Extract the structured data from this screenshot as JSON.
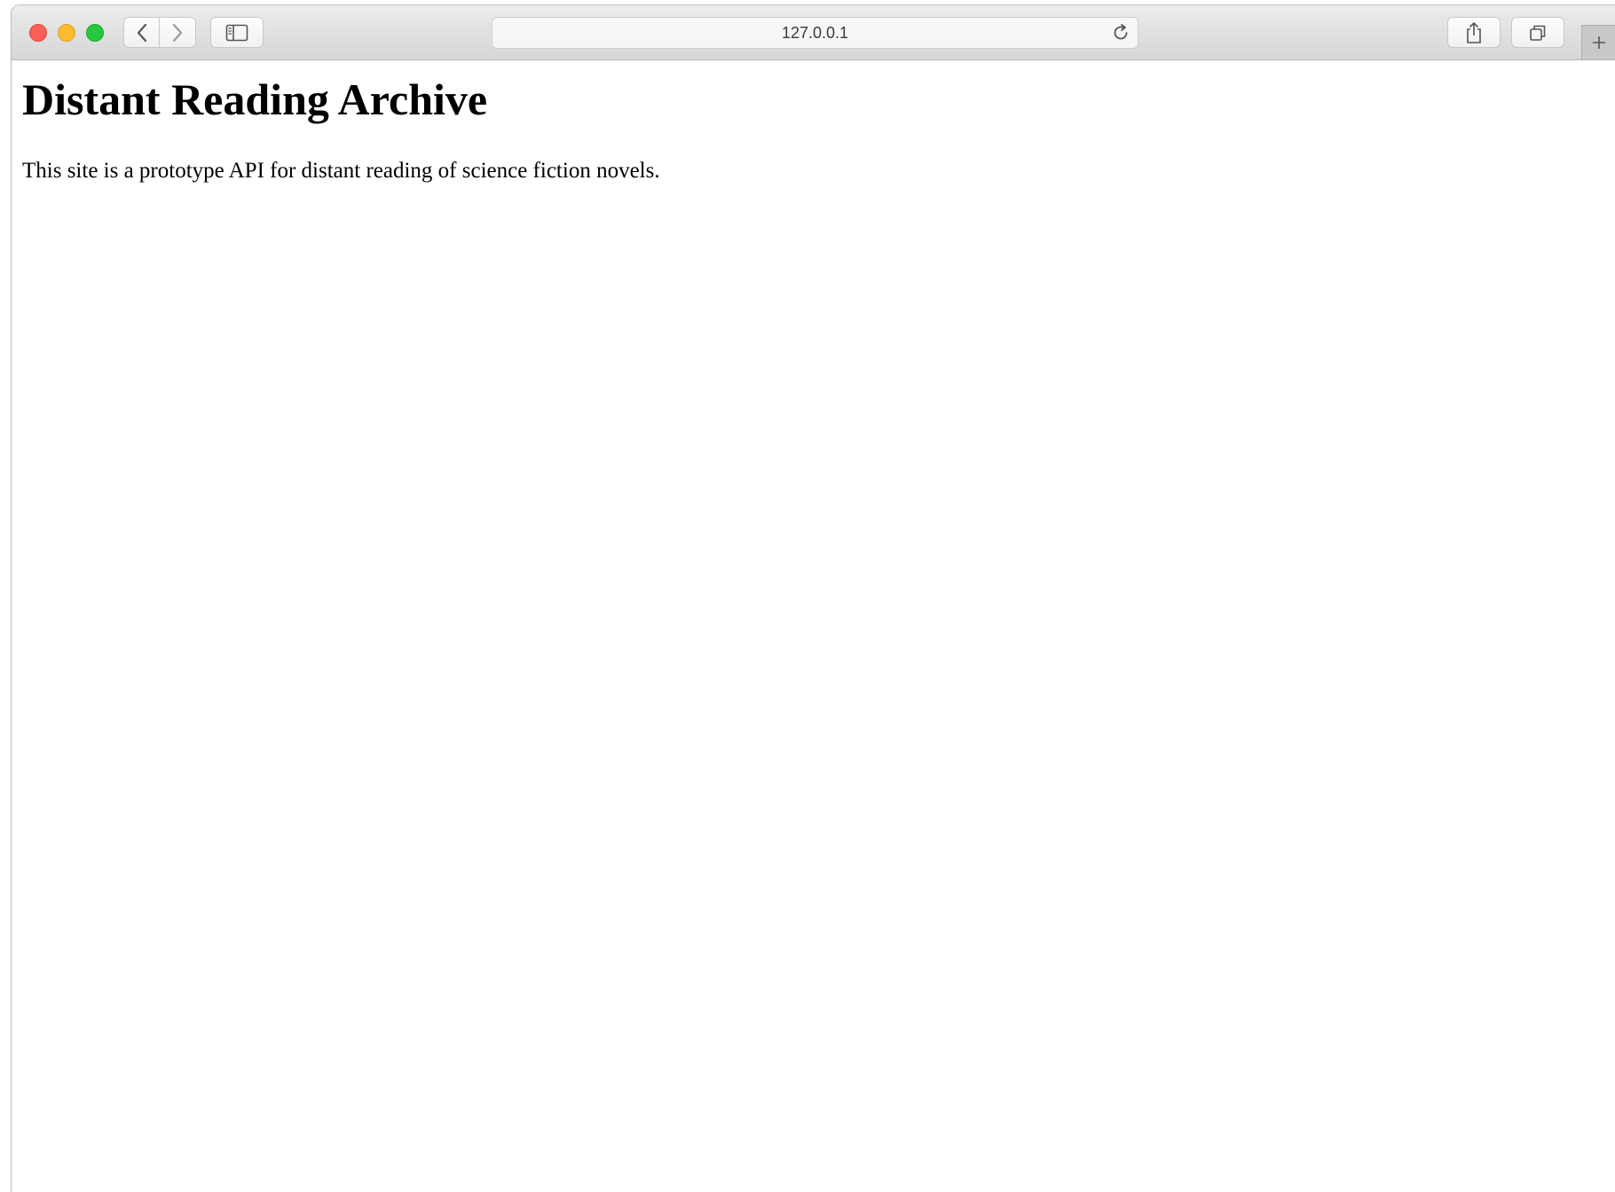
{
  "browser": {
    "address_bar": {
      "url": "127.0.0.1"
    },
    "icons": {
      "back": "chevron-left-icon",
      "forward": "chevron-right-icon",
      "sidebar": "sidebar-icon",
      "reload": "reload-icon",
      "share": "share-icon",
      "tabs": "tab-overview-icon",
      "new_tab": "plus-icon"
    },
    "traffic_lights": {
      "close_color": "#fe5f57",
      "minimize_color": "#febc2e",
      "zoom_color": "#28c840"
    }
  },
  "page": {
    "heading": "Distant Reading Archive",
    "paragraph": "This site is a prototype API for distant reading of science fiction novels."
  }
}
